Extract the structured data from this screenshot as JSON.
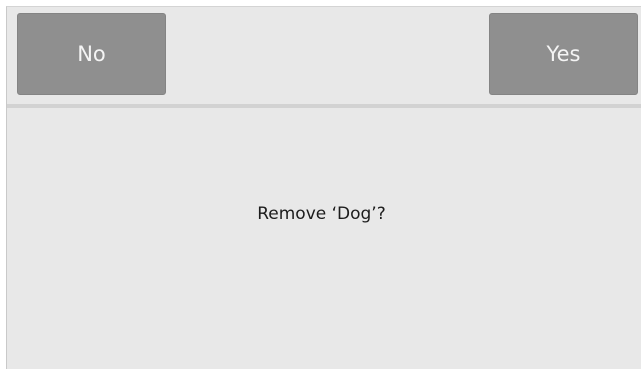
{
  "dialog": {
    "no_label": "No",
    "yes_label": "Yes",
    "message": "Remove ‘Dog’?"
  }
}
